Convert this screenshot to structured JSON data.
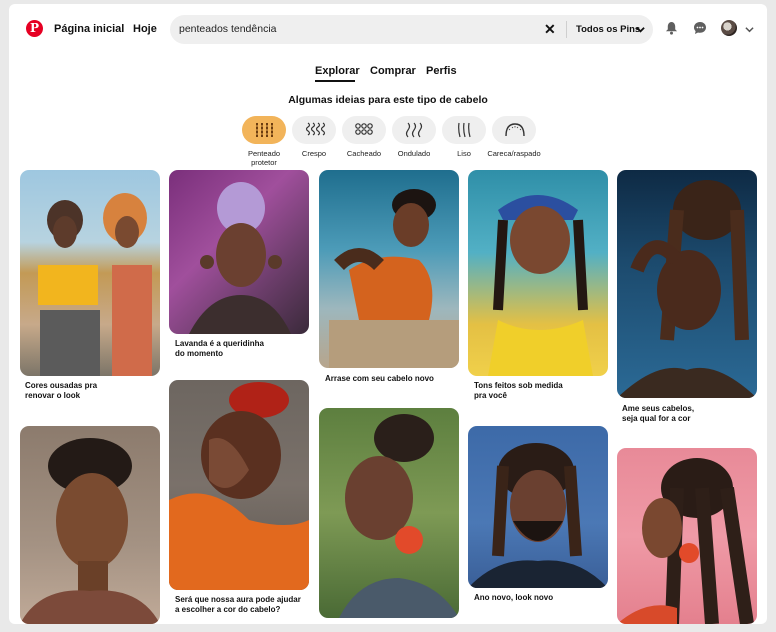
{
  "header": {
    "logo_text": "P",
    "home": "Página inicial",
    "today": "Hoje",
    "search_value": "penteados tendência",
    "scope": "Todos os Pins",
    "icons": [
      "pinterest-logo-icon",
      "clear-icon",
      "chevron-down-icon",
      "bell-icon",
      "chat-icon",
      "avatar",
      "chevron-down-icon"
    ]
  },
  "tabs": [
    {
      "label": "Explorar",
      "active": true
    },
    {
      "label": "Comprar",
      "active": false
    },
    {
      "label": "Perfis",
      "active": false
    }
  ],
  "ideas_title": "Algumas ideias para este tipo de cabelo",
  "filters": [
    {
      "label": "Penteado protetor",
      "active": true
    },
    {
      "label": "Crespo",
      "active": false
    },
    {
      "label": "Cacheado",
      "active": false
    },
    {
      "label": "Ondulado",
      "active": false
    },
    {
      "label": "Liso",
      "active": false
    },
    {
      "label": "Careca/raspado",
      "active": false
    }
  ],
  "pins": [
    {
      "caption": "Cores ousadas pra",
      "caption2": "renovar o look"
    },
    {
      "caption": "Lavanda é a queridinha",
      "caption2": "do momento"
    },
    {
      "caption": "Arrase com seu cabelo novo",
      "caption2": ""
    },
    {
      "caption": "Tons feitos sob medida",
      "caption2": "pra você"
    },
    {
      "caption": "Ame seus cabelos,",
      "caption2": "seja qual for a cor"
    },
    {
      "caption": "",
      "caption2": ""
    },
    {
      "caption": "Será que nossa aura pode ajudar",
      "caption2": "a escolher a cor do cabelo?"
    },
    {
      "caption": "",
      "caption2": ""
    },
    {
      "caption": "Ano novo, look novo",
      "caption2": ""
    },
    {
      "caption": "",
      "caption2": ""
    }
  ],
  "colors": {
    "brand": "#e60023",
    "active_chip": "#f2b45a"
  }
}
